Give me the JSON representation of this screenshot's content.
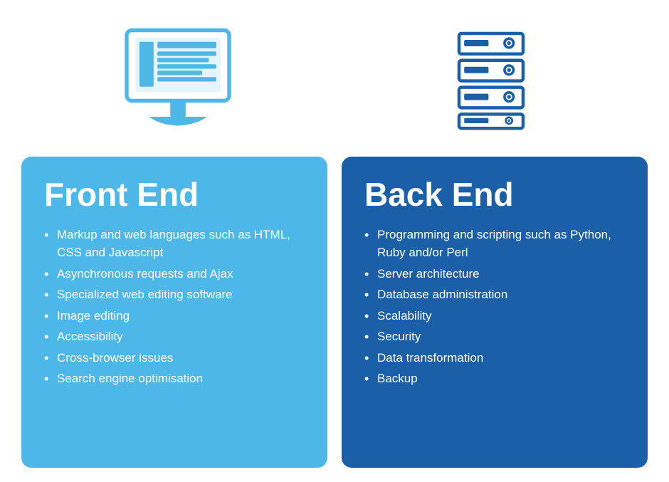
{
  "page": {
    "background": "#ffffff"
  },
  "front_end": {
    "title": "Front End",
    "items": [
      "Markup and web languages such as HTML, CSS and Javascript",
      "Asynchronous requests and Ajax",
      "Specialized web editing software",
      "Image editing",
      "Accessibility",
      "Cross-browser issues",
      "Search engine optimisation"
    ]
  },
  "back_end": {
    "title": "Back End",
    "items": [
      "Programming and scripting such as Python, Ruby and/or Perl",
      "Server architecture",
      "Database administration",
      "Scalability",
      "Security",
      "Data transformation",
      "Backup"
    ]
  },
  "icons": {
    "monitor": "monitor-icon",
    "server": "server-icon"
  }
}
